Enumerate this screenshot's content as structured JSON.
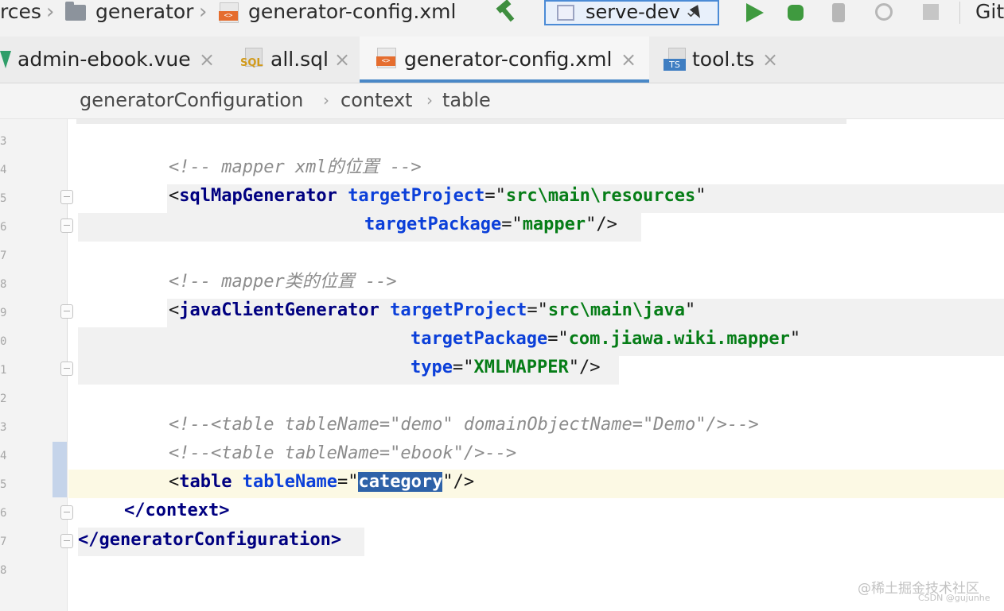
{
  "nav": {
    "crumbs": [
      "rces",
      "generator",
      "generator-config.xml"
    ],
    "xml_badge": "<>",
    "run_config": "serve-dev",
    "git_label": "Git"
  },
  "tabs": [
    {
      "label": "admin-ebook.vue",
      "icon": "vue-icon",
      "active": false
    },
    {
      "label": "all.sql",
      "icon": "sql-file-icon",
      "icon_text": "SQL",
      "active": false
    },
    {
      "label": "generator-config.xml",
      "icon": "xml-file-icon",
      "icon_text": "<>",
      "active": true
    },
    {
      "label": "tool.ts",
      "icon": "ts-file-icon",
      "icon_text": "TS",
      "active": false
    }
  ],
  "tab_close": "×",
  "breadcrumb": {
    "items": [
      "generatorConfiguration",
      "context",
      "table"
    ],
    "separator": "›"
  },
  "code": {
    "comment_sql_map": "<!-- mapper xml的位置 -->",
    "sqlmap_tag": "sqlMapGenerator",
    "target_project_attr": "targetProject",
    "target_package_attr": "targetPackage",
    "type_attr": "type",
    "table_name_attr": "tableName",
    "sqlmap_project": "src\\main\\resources",
    "sqlmap_package": "mapper",
    "comment_java_client": "<!-- mapper类的位置 -->",
    "javaclient_tag": "javaClientGenerator",
    "javaclient_project": "src\\main\\java",
    "javaclient_package": "com.jiawa.wiki.mapper",
    "javaclient_type": "XMLMAPPER",
    "comment_table_demo": "<!--<table tableName=\"demo\" domainObjectName=\"Demo\"/>-->",
    "comment_table_ebook": "<!--<table tableName=\"ebook\"/>-->",
    "table_tag": "table",
    "table_value": "category",
    "close_context": "</context>",
    "close_root": "</generatorConfiguration>"
  },
  "watermark": {
    "line1": "@稀土掘金技术社区",
    "line2": "CSDN @gujunhe"
  },
  "colors": {
    "tag": "#000080",
    "attribute": "#0b3fd9",
    "string": "#067d17",
    "comment": "#8c8c8c",
    "selection": "#2e62a8",
    "active_tab_underline": "#4a88c7"
  }
}
